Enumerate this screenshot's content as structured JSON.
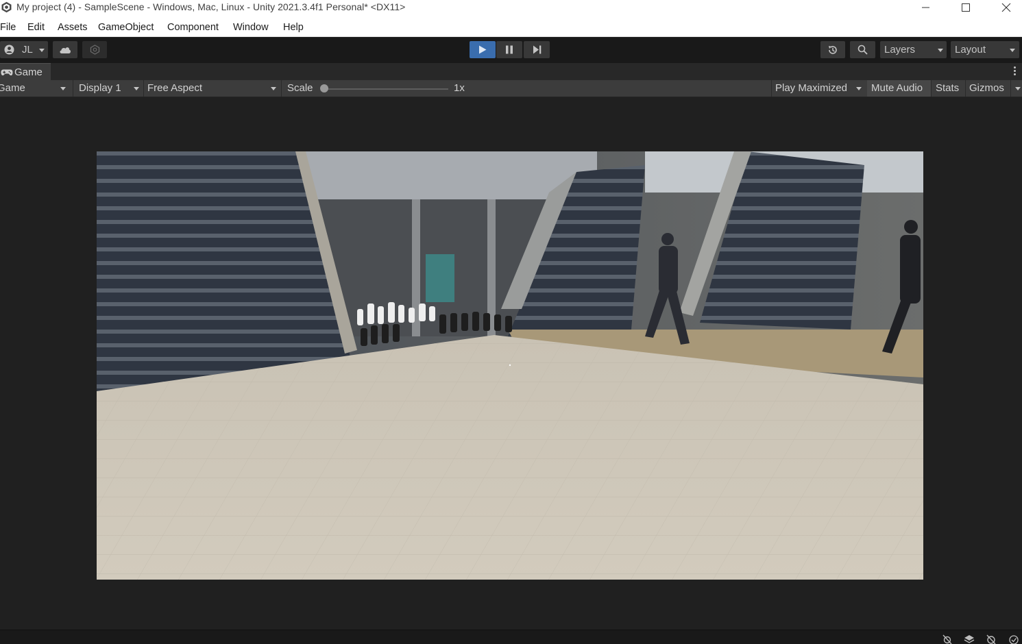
{
  "window": {
    "title": "My project (4) - SampleScene - Windows, Mac, Linux - Unity 2021.3.4f1 Personal* <DX11>",
    "controls": [
      "minimize-icon",
      "maximize-icon",
      "close-icon"
    ]
  },
  "menu": {
    "items": [
      "File",
      "Edit",
      "Assets",
      "GameObject",
      "Component",
      "Window",
      "Help"
    ]
  },
  "toolbar": {
    "account_label": "JL",
    "layers_label": "Layers",
    "layout_label": "Layout",
    "play_state": "playing",
    "accent_color": "#3a6dae"
  },
  "game_tab": {
    "label": "Game",
    "mode_dropdown": "Game",
    "display_dropdown": "Display 1",
    "aspect_dropdown": "Free Aspect",
    "scale_label": "Scale",
    "scale_value": "1x",
    "scale_slider_fraction": 0,
    "play_mode_dropdown": "Play Maximized",
    "mute_audio_label": "Mute Audio",
    "mute_audio_active": true,
    "stats_label": "Stats",
    "gizmos_label": "Gizmos"
  },
  "scene": {
    "description_icon": "game-render-image"
  },
  "statusbar": {
    "icons": [
      "debug-settings-icon",
      "layers-lock-icon",
      "auto-generate-off-icon",
      "check-icon"
    ]
  }
}
